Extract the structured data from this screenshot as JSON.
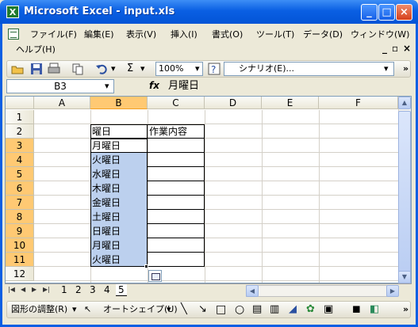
{
  "window": {
    "title": "Microsoft Excel - input.xls"
  },
  "menu": [
    "ファイル(F)",
    "編集(E)",
    "表示(V)",
    "挿入(I)",
    "書式(O)",
    "ツール(T)",
    "データ(D)",
    "ウィンドウ(W)",
    "ヘルプ(H)"
  ],
  "toolbar": {
    "zoom": "100%",
    "sigma": "Σ",
    "scenario": "シナリオ(E)..."
  },
  "formula": {
    "name_box": "B3",
    "fx": "fx",
    "value": "月曜日"
  },
  "grid": {
    "columns": [
      "A",
      "B",
      "C",
      "D",
      "E",
      "F"
    ],
    "rows": [
      "1",
      "2",
      "3",
      "4",
      "5",
      "6",
      "7",
      "8",
      "9",
      "10",
      "11",
      "12"
    ],
    "header_b": "曜日",
    "header_c": "作業内容",
    "b_values": [
      "月曜日",
      "火曜日",
      "水曜日",
      "木曜日",
      "金曜日",
      "土曜日",
      "日曜日",
      "月曜日",
      "火曜日"
    ]
  },
  "sheets": [
    "1",
    "2",
    "3",
    "4",
    "5"
  ],
  "drawing": {
    "adjust": "図形の調整(R)",
    "autoshape": "オートシェイプ(U)"
  },
  "colors": {
    "titlebar": "#0a5fe3",
    "selection": "#bcd0ee",
    "header_selected": "#ffc973"
  }
}
